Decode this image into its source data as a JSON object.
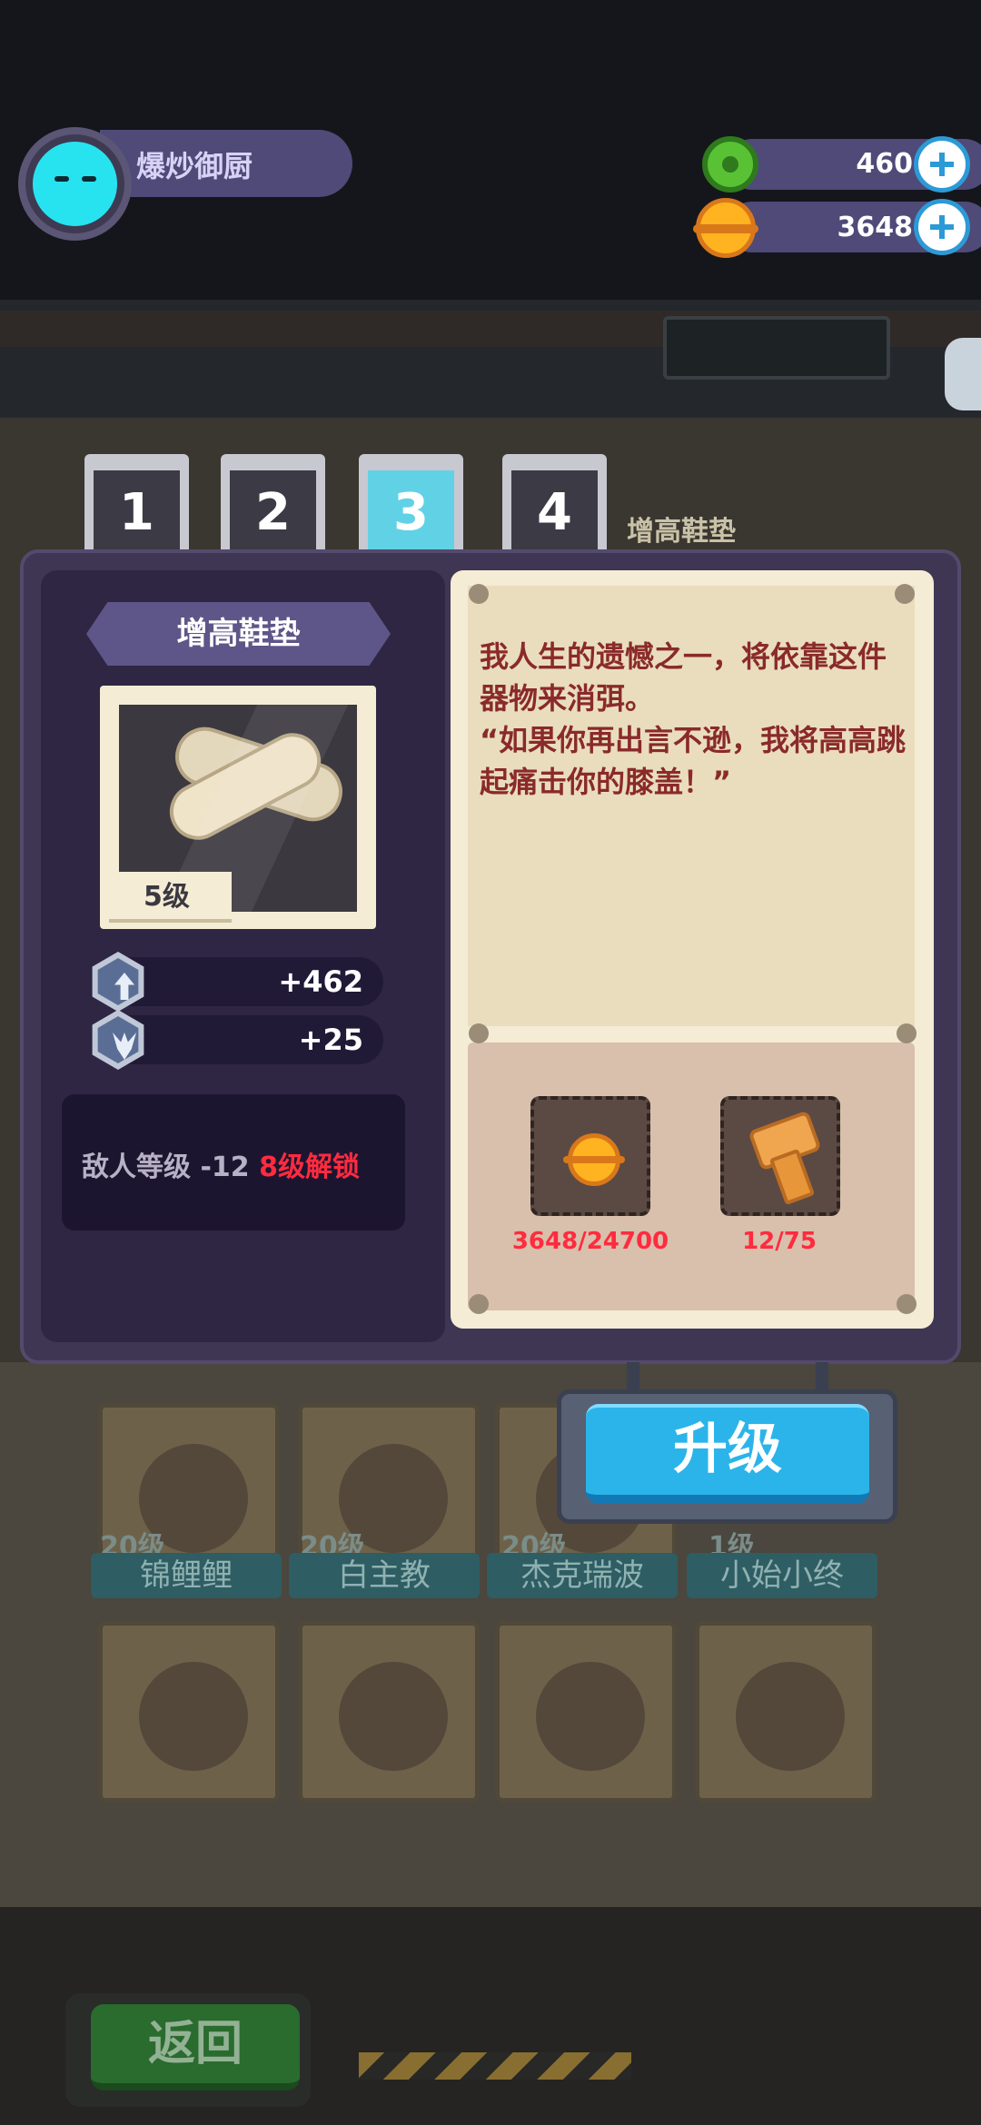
{
  "player": {
    "name": "爆炒御厨",
    "avatar_color": "#27e3f0"
  },
  "resources": [
    {
      "name": "gem",
      "value": "460",
      "icon": "green-gem-icon"
    },
    {
      "name": "coin",
      "value": "3648",
      "icon": "gold-coin-icon"
    }
  ],
  "tabs": [
    {
      "label": "1",
      "active": false
    },
    {
      "label": "2",
      "active": false
    },
    {
      "label": "3",
      "active": true
    },
    {
      "label": "4",
      "active": false
    }
  ],
  "tab_side_label": "增高鞋垫",
  "item": {
    "title": "增高鞋垫",
    "level": "5级",
    "icon": "shoe-insole-icon",
    "stats": [
      {
        "icon": "attack-up-icon",
        "value": "+462"
      },
      {
        "icon": "defense-up-icon",
        "value": "+25"
      }
    ],
    "unlock": {
      "effect": "敌人等级 -12",
      "condition": "8级解锁"
    },
    "description": "我人生的遗憾之一，将依靠这件器物来消弭。\n“如果你再出言不逊，我将高高跳起痛击你的膝盖！”"
  },
  "costs": [
    {
      "icon": "gold-coin-icon",
      "amount": "3648/24700"
    },
    {
      "icon": "bolt-material-icon",
      "amount": "12/75"
    }
  ],
  "buttons": {
    "upgrade": "升级",
    "back": "返回"
  },
  "background_characters": [
    {
      "name": "锦鲤鲤",
      "level": "20级"
    },
    {
      "name": "白主教",
      "level": "20级"
    },
    {
      "name": "杰克瑞波",
      "level": "20级"
    },
    {
      "name": "小始小终",
      "level": "1级"
    }
  ],
  "colors": {
    "modal": "#3f3654",
    "paper": "#f4ecd4",
    "upgrade": "#2bb4ea",
    "warning_red": "#ff2b3f"
  }
}
